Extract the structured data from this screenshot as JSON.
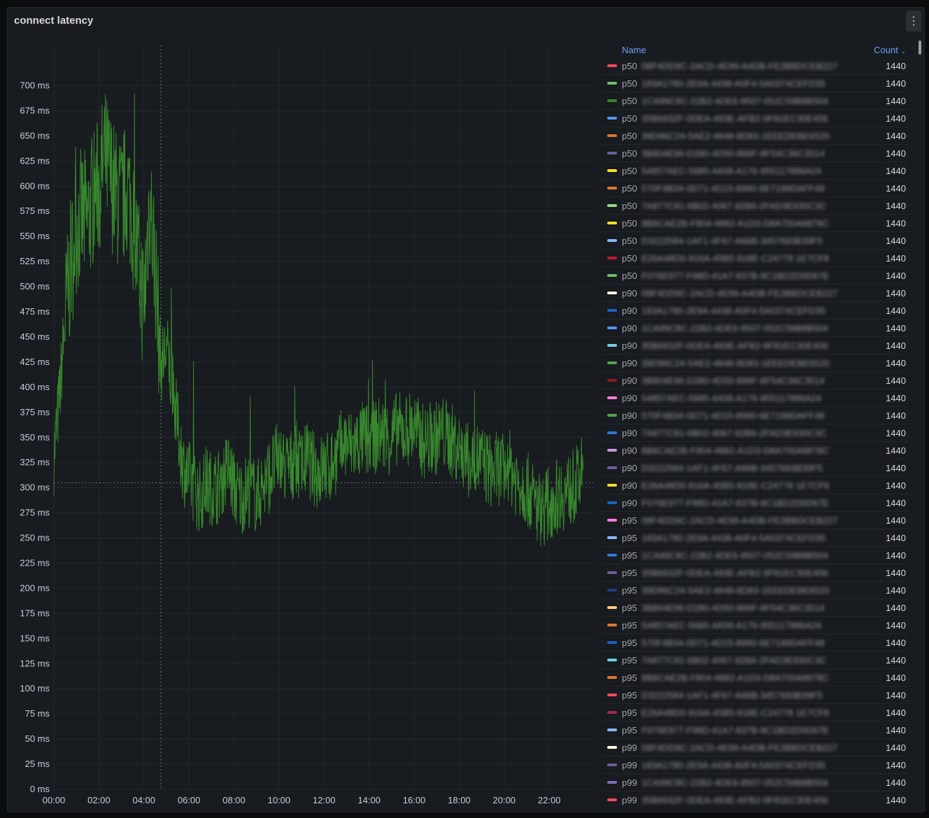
{
  "panel": {
    "title": "connect latency",
    "menu_icon": "kebab-menu-icon"
  },
  "legend": {
    "name_header": "Name",
    "count_header": "Count",
    "sort_icon": "chevron-down-icon",
    "rows": [
      {
        "prefix": "p50",
        "id": "08F4DD9C-2ACD-4E99-A4DB-FE2BBDCEB227",
        "count": "1440",
        "color": "#f2495c"
      },
      {
        "prefix": "p50",
        "id": "183A1780-2E9A-4438-A0F4-5A0374CEFD35",
        "count": "1440",
        "color": "#73bf69"
      },
      {
        "prefix": "p50",
        "id": "1CA99C8C-22B2-4DE6-9507-052C59B8B504",
        "count": "1440",
        "color": "#37872d"
      },
      {
        "prefix": "p50",
        "id": "35B6932F-0DEA-493E-AFB2-9F81EC30E456",
        "count": "1440",
        "color": "#5794f2"
      },
      {
        "prefix": "p50",
        "id": "39D96C24-5AE2-4848-8D83-1EEEDEBE6520",
        "count": "1440",
        "color": "#e0752d"
      },
      {
        "prefix": "p50",
        "id": "3B804E96-D280-4D50-886F-8F54C36C3514",
        "count": "1440",
        "color": "#705da0"
      },
      {
        "prefix": "p50",
        "id": "54857AEC-5685-4A58-A176-955117886A24",
        "count": "1440",
        "color": "#fade2a"
      },
      {
        "prefix": "p50",
        "id": "570F4B34-0D71-4D15-8990-6E7199DAFF48",
        "count": "1440",
        "color": "#e0752d"
      },
      {
        "prefix": "p50",
        "id": "7A877C81-6B02-4067-92B6-2FAD3E930C3C",
        "count": "1440",
        "color": "#96d98d"
      },
      {
        "prefix": "p50",
        "id": "8B6CAE2B-F804-4882-A1D3-D8A700A8878C",
        "count": "1440",
        "color": "#fade2a"
      },
      {
        "prefix": "p50",
        "id": "D3222584-1AF1-4F67-A66B-3457693B39F5",
        "count": "1440",
        "color": "#8ab8ff"
      },
      {
        "prefix": "p50",
        "id": "E26A48D0-916A-45B5-918E-C24778 1E7CF8",
        "count": "1440",
        "color": "#c4162a"
      },
      {
        "prefix": "p50",
        "id": "F076E977-F98D-41A7-837B-9C1BD2D0D67E",
        "count": "1440",
        "color": "#73bf69"
      },
      {
        "prefix": "p90",
        "id": "08F4DD9C-2ACD-4E99-A4DB-FE2BBDCEB227",
        "count": "1440",
        "color": "#fff4dd"
      },
      {
        "prefix": "p90",
        "id": "183A1780-2E9A-4438-A0F4-5A0374CEFD35",
        "count": "1440",
        "color": "#1f60c4"
      },
      {
        "prefix": "p90",
        "id": "1CA99C8C-22B2-4DE6-9507-052C59B8B504",
        "count": "1440",
        "color": "#5794f2"
      },
      {
        "prefix": "p90",
        "id": "35B6932F-0DEA-493E-AFB2-9F81EC30E456",
        "count": "1440",
        "color": "#6ed0e0"
      },
      {
        "prefix": "p90",
        "id": "39D96C24-5AE2-4848-8D83-1EEEDEBE6520",
        "count": "1440",
        "color": "#56a64b"
      },
      {
        "prefix": "p90",
        "id": "3B804E96-D280-4D50-886F-8F54C36C3514",
        "count": "1440",
        "color": "#8f1a1a"
      },
      {
        "prefix": "p90",
        "id": "54857AEC-5685-4A58-A176-955117886A24",
        "count": "1440",
        "color": "#ff7ed4"
      },
      {
        "prefix": "p90",
        "id": "570F4B34-0D71-4D15-8990-6E7199DAFF48",
        "count": "1440",
        "color": "#56a64b"
      },
      {
        "prefix": "p90",
        "id": "7A877C81-6B02-4067-92B6-2FAD3E930C3C",
        "count": "1440",
        "color": "#3274d9"
      },
      {
        "prefix": "p90",
        "id": "8B6CAE2B-F804-4882-A1D3-D8A700A8878C",
        "count": "1440",
        "color": "#ca95e5"
      },
      {
        "prefix": "p90",
        "id": "D3222584-1AF1-4F67-A66B-3457693B39F5",
        "count": "1440",
        "color": "#705da0"
      },
      {
        "prefix": "p90",
        "id": "E26A48D0-916A-45B5-918E-C24778 1E7CF8",
        "count": "1440",
        "color": "#fade2a"
      },
      {
        "prefix": "p90",
        "id": "F076E977-F98D-41A7-837B-9C1BD2D0D67E",
        "count": "1440",
        "color": "#1f60c4"
      },
      {
        "prefix": "p95",
        "id": "08F4DD9C-2ACD-4E99-A4DB-FE2BBDCEB227",
        "count": "1440",
        "color": "#ff7ed4"
      },
      {
        "prefix": "p95",
        "id": "183A1780-2E9A-4438-A0F4-5A0374CEFD35",
        "count": "1440",
        "color": "#8ab8ff"
      },
      {
        "prefix": "p95",
        "id": "1CA99C8C-22B2-4DE6-9507-052C59B8B504",
        "count": "1440",
        "color": "#3274d9"
      },
      {
        "prefix": "p95",
        "id": "35B6932F-0DEA-493E-AFB2-9F81EC30E456",
        "count": "1440",
        "color": "#705da0"
      },
      {
        "prefix": "p95",
        "id": "39D96C24-5AE2-4848-8D83-1EEEDEBE6520",
        "count": "1440",
        "color": "#1f3f7f"
      },
      {
        "prefix": "p95",
        "id": "3B804E96-D280-4D50-886F-8F54C36C3514",
        "count": "1440",
        "color": "#ffcb7d"
      },
      {
        "prefix": "p95",
        "id": "54857AEC-5685-4A58-A176-955117886A24",
        "count": "1440",
        "color": "#e0752d"
      },
      {
        "prefix": "p95",
        "id": "570F4B34-0D71-4D15-8990-6E7199DAFF48",
        "count": "1440",
        "color": "#1f60c4"
      },
      {
        "prefix": "p95",
        "id": "7A877C81-6B02-4067-92B6-2FAD3E930C3C",
        "count": "1440",
        "color": "#6ed0e0"
      },
      {
        "prefix": "p95",
        "id": "8B6CAE2B-F804-4882-A1D3-D8A700A8878C",
        "count": "1440",
        "color": "#e0752d"
      },
      {
        "prefix": "p95",
        "id": "D3222584-1AF1-4F67-A66B-3457693B39F5",
        "count": "1440",
        "color": "#f2495c"
      },
      {
        "prefix": "p95",
        "id": "E26A48D0-916A-45B5-918E-C24778 1E7CF8",
        "count": "1440",
        "color": "#a3285c"
      },
      {
        "prefix": "p95",
        "id": "F076E977-F98D-41A7-837B-9C1BD2D0D67E",
        "count": "1440",
        "color": "#8ab8ff"
      },
      {
        "prefix": "p99",
        "id": "08F4DD9C-2ACD-4E99-A4DB-FE2BBDCEB227",
        "count": "1440",
        "color": "#fff4dd"
      },
      {
        "prefix": "p99",
        "id": "183A1780-2E9A-4438-A0F4-5A0374CEFD35",
        "count": "1440",
        "color": "#705da0"
      },
      {
        "prefix": "p99",
        "id": "1CA99C8C-22B2-4DE6-9507-052C59B8B504",
        "count": "1440",
        "color": "#806eb7"
      },
      {
        "prefix": "p99",
        "id": "35B6932F-0DEA-493E-AFB2-9F81EC30E456",
        "count": "1440",
        "color": "#f2495c"
      }
    ]
  },
  "chart_data": {
    "type": "line",
    "ylabel": "",
    "xlabel": "",
    "y_unit": "ms",
    "ylim": [
      0,
      740
    ],
    "xlim": [
      "00:00",
      "23:59"
    ],
    "y_ticks": [
      "0 ms",
      "25 ms",
      "50 ms",
      "75 ms",
      "100 ms",
      "125 ms",
      "150 ms",
      "175 ms",
      "200 ms",
      "225 ms",
      "250 ms",
      "275 ms",
      "300 ms",
      "325 ms",
      "350 ms",
      "375 ms",
      "400 ms",
      "425 ms",
      "450 ms",
      "475 ms",
      "500 ms",
      "525 ms",
      "550 ms",
      "575 ms",
      "600 ms",
      "625 ms",
      "650 ms",
      "675 ms",
      "700 ms"
    ],
    "x_ticks": [
      "00:00",
      "02:00",
      "04:00",
      "06:00",
      "08:00",
      "10:00",
      "12:00",
      "14:00",
      "16:00",
      "18:00",
      "20:00",
      "22:00"
    ],
    "grid": true,
    "series_color": "#37872d",
    "series": [
      {
        "x": [
          "00:00",
          "00:15",
          "00:30",
          "00:45",
          "01:00",
          "01:15",
          "01:30",
          "01:45",
          "02:00",
          "02:15",
          "02:30",
          "02:45",
          "03:00",
          "03:15",
          "03:30",
          "03:45",
          "04:00",
          "04:15",
          "04:30",
          "04:45",
          "05:00",
          "05:15",
          "05:30",
          "05:45",
          "06:00",
          "06:15",
          "06:30",
          "06:45",
          "07:00",
          "07:15",
          "07:30",
          "07:45",
          "08:00",
          "08:15",
          "08:30",
          "08:45",
          "09:00",
          "09:15",
          "09:30",
          "09:45",
          "10:00",
          "10:15",
          "10:30",
          "10:45",
          "11:00",
          "11:15",
          "11:30",
          "11:45",
          "12:00",
          "12:15",
          "12:30",
          "12:45",
          "13:00",
          "13:15",
          "13:30",
          "13:45",
          "14:00",
          "14:15",
          "14:30",
          "14:45",
          "15:00",
          "15:15",
          "15:30",
          "15:45",
          "16:00",
          "16:15",
          "16:30",
          "16:45",
          "17:00",
          "17:15",
          "17:30",
          "17:45",
          "18:00",
          "18:15",
          "18:30",
          "18:45",
          "19:00",
          "19:15",
          "19:30",
          "19:45",
          "20:00",
          "20:15",
          "20:30",
          "20:45",
          "21:00",
          "21:15",
          "21:30",
          "21:45",
          "22:00",
          "22:15",
          "22:30",
          "22:45",
          "23:00",
          "23:15",
          "23:30"
        ],
        "values": [
          330,
          390,
          470,
          520,
          560,
          570,
          565,
          590,
          600,
          630,
          610,
          590,
          580,
          600,
          570,
          520,
          480,
          590,
          520,
          420,
          440,
          400,
          360,
          320,
          310,
          300,
          290,
          305,
          300,
          300,
          310,
          320,
          300,
          290,
          295,
          300,
          290,
          300,
          310,
          320,
          330,
          320,
          320,
          330,
          320,
          330,
          320,
          315,
          320,
          320,
          330,
          340,
          345,
          340,
          345,
          350,
          345,
          350,
          355,
          350,
          350,
          360,
          355,
          360,
          360,
          350,
          345,
          350,
          350,
          355,
          350,
          345,
          340,
          330,
          325,
          330,
          325,
          320,
          315,
          320,
          315,
          320,
          310,
          305,
          300,
          290,
          280,
          280,
          285,
          290,
          295,
          295,
          300,
          305,
          315
        ]
      }
    ]
  }
}
